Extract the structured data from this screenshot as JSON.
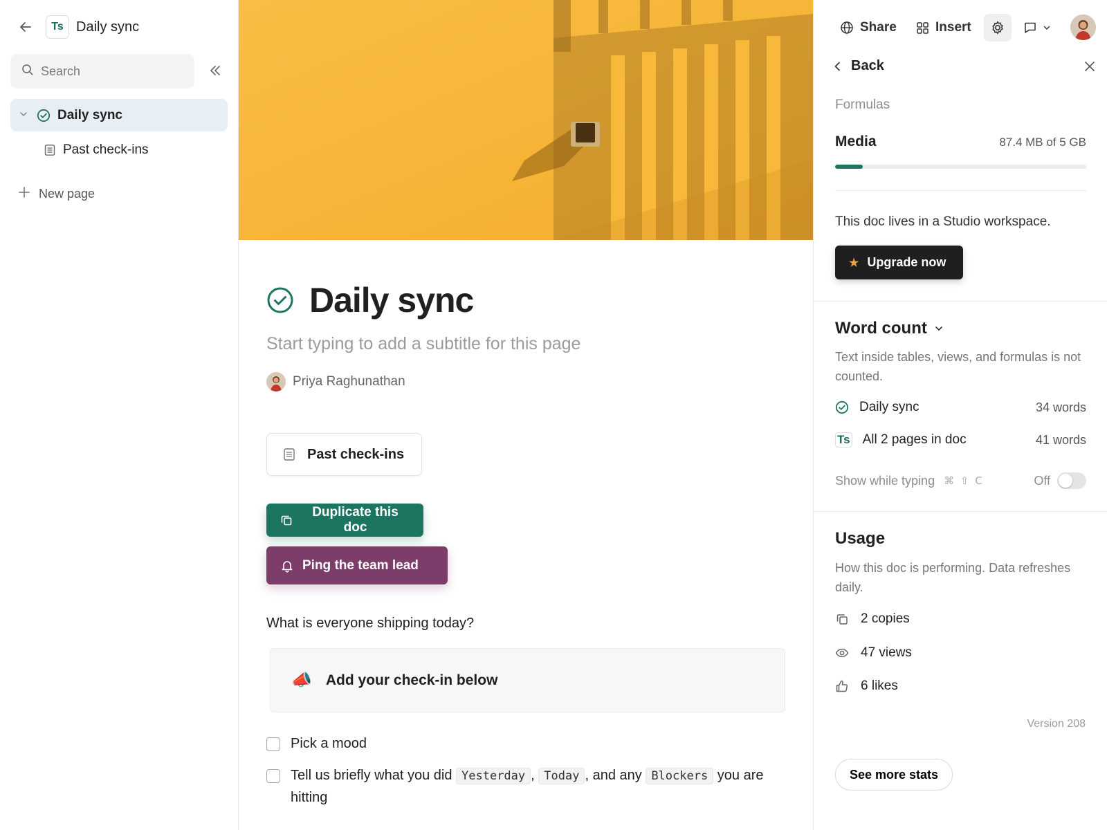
{
  "sidebar": {
    "doc_badge": "Ts",
    "doc_title": "Daily sync",
    "search_placeholder": "Search",
    "items": [
      {
        "label": "Daily sync",
        "icon": "check-circle-icon",
        "active": true
      },
      {
        "label": "Past check-ins",
        "icon": "page-icon",
        "active": false
      }
    ],
    "new_page_label": "New page"
  },
  "main": {
    "title": "Daily sync",
    "subtitle_placeholder": "Start typing to add a subtitle for this page",
    "author": "Priya Raghunathan",
    "subpage_card": "Past check-ins",
    "duplicate_button": "Duplicate this doc",
    "ping_button": "Ping the team lead",
    "question": "What is everyone shipping today?",
    "callout": {
      "emoji": "📣",
      "text": "Add your check-in below"
    },
    "todos": [
      {
        "text": "Pick a mood",
        "checked": false
      },
      {
        "parts": {
          "before": "Tell us briefly what you did",
          "code1": "Yesterday",
          "sep1": ",",
          "code2": "Today",
          "sep2": ", and any",
          "code3": "Blockers",
          "after": "you are hitting"
        },
        "checked": false
      }
    ]
  },
  "panel": {
    "share_label": "Share",
    "insert_label": "Insert",
    "back_label": "Back",
    "formulas_label": "Formulas",
    "media": {
      "title": "Media",
      "value": "87.4 MB of 5 GB",
      "used_fraction": 0.11
    },
    "workspace_text": "This doc lives in a Studio workspace.",
    "upgrade_label": "Upgrade now",
    "word_count": {
      "title": "Word count",
      "desc": "Text inside tables, views, and formulas is not counted.",
      "rows": [
        {
          "label": "Daily sync",
          "value": "34 words"
        },
        {
          "label": "All 2 pages in doc",
          "value": "41 words",
          "badge": "Ts"
        }
      ],
      "show_while_typing": "Show while typing",
      "shortcut": "⌘ ⇧ C",
      "toggle_state": "Off"
    },
    "usage": {
      "title": "Usage",
      "desc": "How this doc is performing. Data refreshes daily.",
      "copies": "2 copies",
      "views": "47 views",
      "likes": "6 likes"
    },
    "version": "Version 208",
    "see_more_label": "See more stats"
  },
  "colors": {
    "accent_green": "#1b7560",
    "accent_purple": "#7d3d6a",
    "cover_yellow": "#f6b534",
    "active_nav_bg": "#e8eef5"
  }
}
